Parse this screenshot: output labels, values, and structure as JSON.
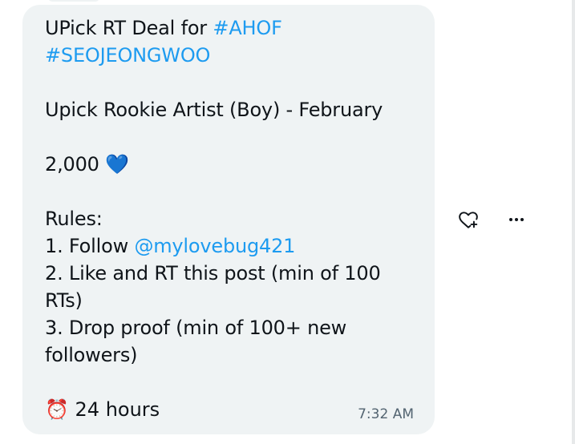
{
  "message": {
    "line1_text": "UPick RT Deal for ",
    "hashtag1": "#AHOF",
    "hashtag2": "#SEOJEONGWOO",
    "line3": "Upick Rookie Artist (Boy) - February",
    "count_text": "2,000",
    "count_emoji": "💙",
    "rules_title": "Rules:",
    "rule1_text": "1. Follow ",
    "rule1_mention": "@mylovebug421",
    "rule2": "2. Like and RT this post (min of 100 RTs)",
    "rule3": "3. Drop proof (min of 100+ new followers)",
    "timer_emoji": "⏰",
    "timer_text": " 24 hours",
    "timestamp": "7:32 AM"
  },
  "actions": {
    "react_icon": "heart-plus-icon",
    "more_icon": "more-horizontal-icon"
  },
  "colors": {
    "bubble": "#eff3f4",
    "text": "#0f1419",
    "link": "#1d9bf0",
    "muted": "#536471"
  }
}
